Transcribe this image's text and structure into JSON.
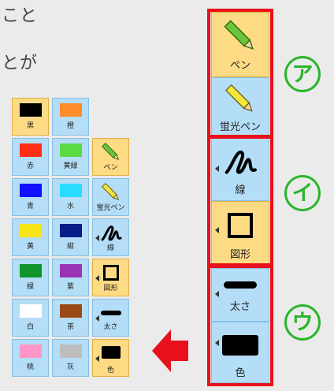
{
  "text": {
    "line1": "こと",
    "line2": "とが"
  },
  "colors": [
    {
      "label": "黒",
      "hex": "#000000",
      "selected": true
    },
    {
      "label": "橙",
      "hex": "#ff8c28"
    },
    {
      "label": "赤",
      "hex": "#ff2e14"
    },
    {
      "label": "黄緑",
      "hex": "#5cda44"
    },
    {
      "label": "青",
      "hex": "#1111ff"
    },
    {
      "label": "水",
      "hex": "#28dcff"
    },
    {
      "label": "黄",
      "hex": "#f7e519"
    },
    {
      "label": "紺",
      "hex": "#061c86"
    },
    {
      "label": "緑",
      "hex": "#10952c"
    },
    {
      "label": "紫",
      "hex": "#9a34b5"
    },
    {
      "label": "白",
      "hex": "#ffffff"
    },
    {
      "label": "茶",
      "hex": "#9a4a14"
    },
    {
      "label": "桃",
      "hex": "#ff96c8"
    },
    {
      "label": "灰",
      "hex": "#bdbdbd"
    }
  ],
  "palette_tools": {
    "pen": "ペン",
    "highlighter": "蛍光ペン",
    "line": "線",
    "shape": "図形",
    "thickness": "太さ",
    "color": "色"
  },
  "panel": {
    "pen": "ペン",
    "highlighter": "蛍光ペン",
    "line": "線",
    "shape": "図形",
    "thickness": "太さ",
    "color": "色"
  },
  "markers": {
    "a": "ア",
    "i": "イ",
    "u": "ウ"
  },
  "accent": {
    "red": "#e8101a",
    "green": "#2bb52b",
    "selected": "#fddb84",
    "cell": "#b4ddf7"
  }
}
